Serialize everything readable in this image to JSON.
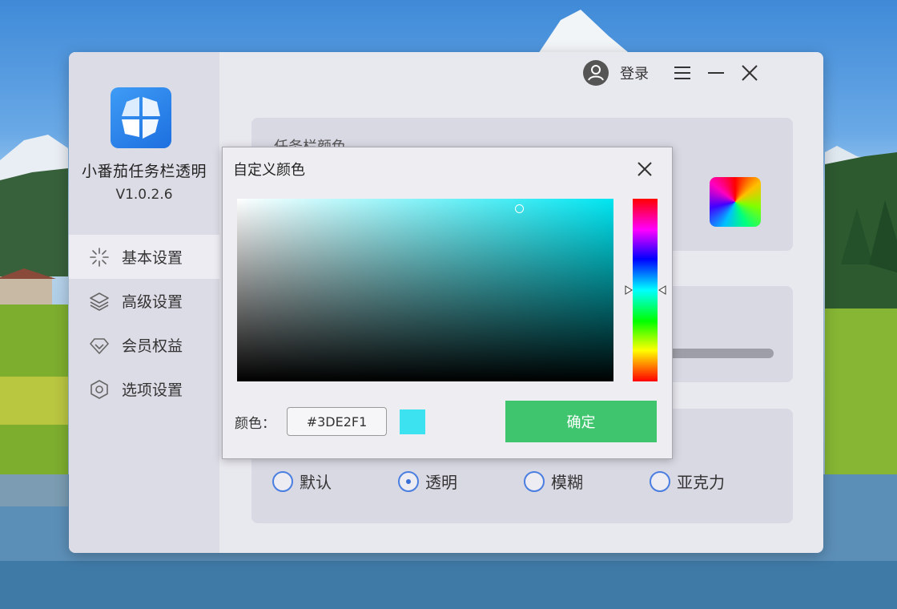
{
  "app": {
    "name": "小番茄任务栏透明",
    "version": "V1.0.2.6"
  },
  "sidebar": {
    "items": [
      {
        "label": "基本设置",
        "icon": "sparkle-icon",
        "active": true
      },
      {
        "label": "高级设置",
        "icon": "layers-icon",
        "active": false
      },
      {
        "label": "会员权益",
        "icon": "diamond-icon",
        "active": false
      },
      {
        "label": "选项设置",
        "icon": "hexagon-icon",
        "active": false
      }
    ]
  },
  "header": {
    "login_label": "登录",
    "icons": [
      "user-avatar-icon",
      "menu-icon",
      "minimize-icon",
      "close-icon"
    ]
  },
  "main": {
    "taskbar_color_title": "任务栏颜色",
    "style_options": [
      {
        "label": "默认",
        "selected": false
      },
      {
        "label": "透明",
        "selected": true
      },
      {
        "label": "模糊",
        "selected": false
      },
      {
        "label": "亚克力",
        "selected": false
      }
    ]
  },
  "color_dialog": {
    "title": "自定义颜色",
    "color_label": "颜色：",
    "hex_value": "#3DE2F1",
    "swatch_color": "#3DE2F1",
    "confirm_label": "确定"
  },
  "colors": {
    "accent_green": "#3FC56E",
    "radio_blue": "#4A7EE0",
    "logo_blue": "#2A86F0"
  }
}
